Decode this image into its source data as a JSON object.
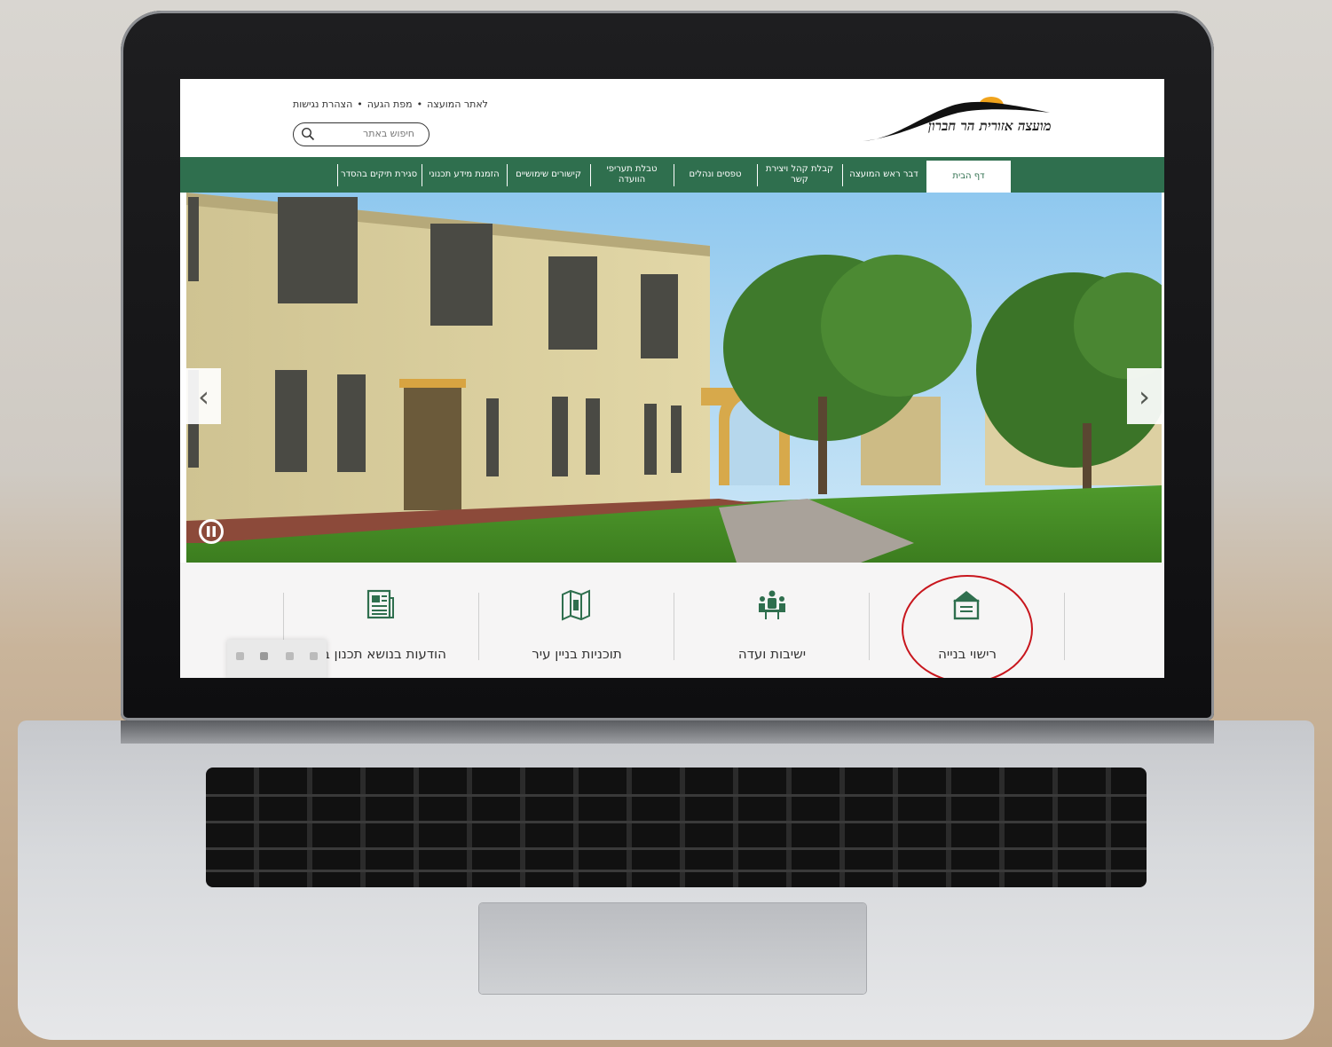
{
  "site": {
    "logo_text": "מועצה אזורית הר חברון"
  },
  "header": {
    "links": [
      "לאתר המועצה",
      "מפת הגעה",
      "הצהרת נגישות"
    ],
    "search_placeholder": "חיפוש באתר"
  },
  "nav": {
    "items": [
      "דף הבית",
      "דבר ראש המועצה",
      "קבלת קהל ויצירת קשר",
      "טפסים ונהלים",
      "טבלת תעריפי הוועדה",
      "קישורים שימושיים",
      "הזמנת מידע תכנוני",
      "סגירת תיקים בהסדר"
    ],
    "active_index": 0
  },
  "hero": {
    "prev_arrow": "‹",
    "next_arrow": "›"
  },
  "cards": [
    {
      "label": "רישוי בנייה",
      "icon": "house-document-icon"
    },
    {
      "label": "ישיבות ועדה",
      "icon": "committee-meeting-icon"
    },
    {
      "label": "תוכניות בניין עיר",
      "icon": "map-plans-icon"
    },
    {
      "label": "הודעות בנושא תכנון בנ",
      "icon": "newspaper-icon"
    }
  ],
  "colors": {
    "brand_green": "#2f6f4e",
    "highlight_red": "#c8161d",
    "logo_sun": "#f0a31c"
  }
}
